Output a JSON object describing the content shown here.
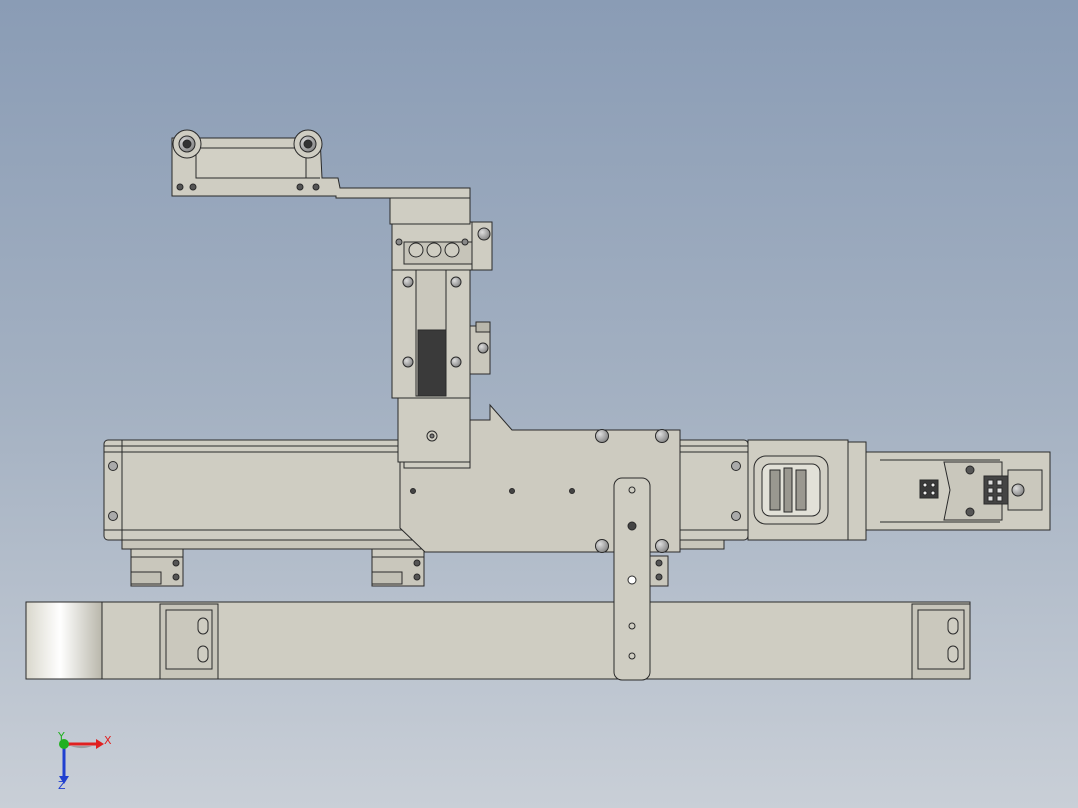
{
  "triad": {
    "x_label": "X",
    "y_label": "Y",
    "z_label": "Z"
  },
  "colors": {
    "background_top": "#8a9cb5",
    "background_bottom": "#c9cfd7",
    "part_fill": "#cfcdc2",
    "part_fill_dark": "#bdbbb0",
    "edge": "#2a2a2a",
    "axis_x": "#e02020",
    "axis_y": "#20b020",
    "axis_z": "#2040d0"
  }
}
